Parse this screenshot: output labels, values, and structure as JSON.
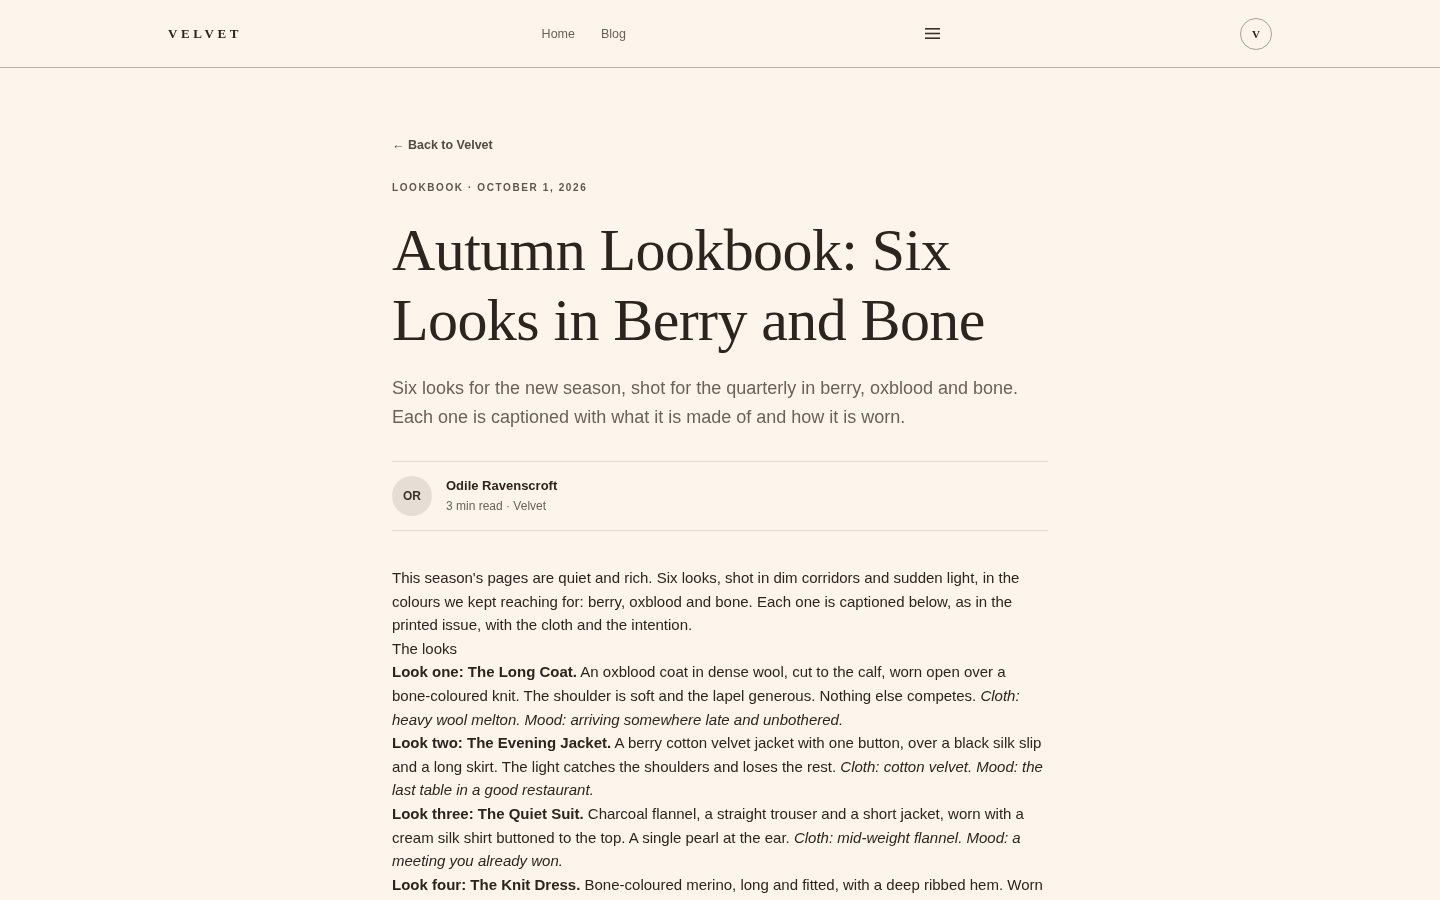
{
  "header": {
    "logo": "VELVET",
    "nav": [
      {
        "label": "Home"
      },
      {
        "label": "Blog"
      }
    ],
    "account_initial": "V"
  },
  "article": {
    "back_link": "← Back to Velvet",
    "kicker": "LOOKBOOK · OCTOBER 1, 2026",
    "title": "Autumn Lookbook: Six Looks in Berry and Bone",
    "subtitle": "Six looks for the new season, shot for the quarterly in berry, oxblood and bone. Each one is captioned with what it is made of and how it is worn.",
    "author": {
      "initials": "OR",
      "name": "Odile Ravenscroft",
      "meta": "3 min read · Velvet"
    },
    "body": {
      "intro": "This season's pages are quiet and rich. Six looks, shot in dim corridors and sudden light, in the colours we kept reaching for: berry, oxblood and bone. Each one is captioned below, as in the printed issue, with the cloth and the intention.",
      "section_heading": "The looks",
      "looks": [
        "**Look one: The Long Coat.** An oxblood coat in dense wool, cut to the calf, worn open over a bone-coloured knit. The shoulder is soft and the lapel generous. Nothing else competes. *Cloth: heavy wool melton. Mood: arriving somewhere late and unbothered.*",
        "**Look two: The Evening Jacket.** A berry cotton velvet jacket with one button, over a black silk slip and a long skirt. The light catches the shoulders and loses the rest. *Cloth: cotton velvet. Mood: the last table in a good restaurant.*",
        "**Look three: The Quiet Suit.** Charcoal flannel, a straight trouser and a short jacket, worn with a cream silk shirt buttoned to the top. A single pearl at the ear. *Cloth: mid-weight flannel. Mood: a meeting you already won.*",
        "**Look four: The Knit Dress.** Bone-coloured merino, long and fitted, with a deep ribbed hem. Worn"
      ]
    }
  }
}
